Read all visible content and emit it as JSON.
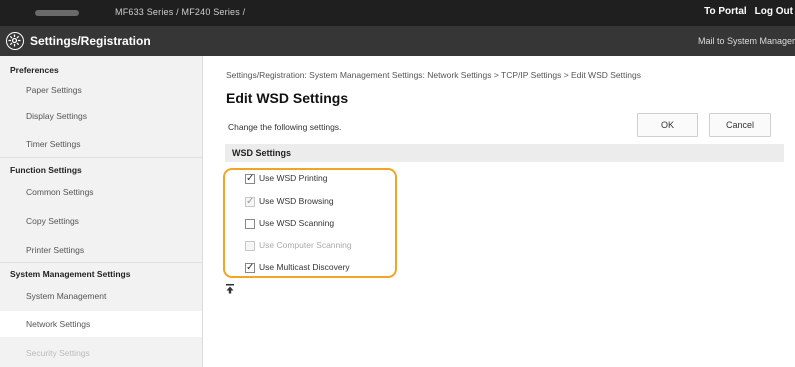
{
  "header": {
    "model_text": "MF633 Series / MF240 Series /",
    "portal_link": "To Portal",
    "logout_link": "Log Out"
  },
  "titlebar": {
    "title": "Settings/Registration",
    "mail_link": "Mail to System Manager"
  },
  "sidebar": {
    "sections": [
      {
        "label": "Preferences",
        "items": [
          "Paper Settings",
          "Display Settings",
          "Timer Settings"
        ]
      },
      {
        "label": "Function Settings",
        "items": [
          "Common Settings",
          "Copy Settings",
          "Printer Settings"
        ]
      },
      {
        "label": "System Management Settings",
        "items": [
          "System Management",
          "Network Settings",
          "Security Settings"
        ]
      }
    ],
    "active_item": "Network Settings"
  },
  "main": {
    "breadcrumb": "Settings/Registration: System Management Settings: Network Settings > TCP/IP Settings > Edit WSD Settings",
    "page_title": "Edit WSD Settings",
    "instruction": "Change the following settings.",
    "ok_label": "OK",
    "cancel_label": "Cancel",
    "panel_title": "WSD Settings",
    "options": [
      {
        "label": "Use WSD Printing",
        "checked": true,
        "disabled": false
      },
      {
        "label": "Use WSD Browsing",
        "checked": true,
        "disabled": true
      },
      {
        "label": "Use WSD Scanning",
        "checked": false,
        "disabled": false
      },
      {
        "label": "Use Computer Scanning",
        "checked": false,
        "disabled": true
      },
      {
        "label": "Use Multicast Discovery",
        "checked": true,
        "disabled": false
      }
    ],
    "highlight_color": "#f2a425"
  }
}
